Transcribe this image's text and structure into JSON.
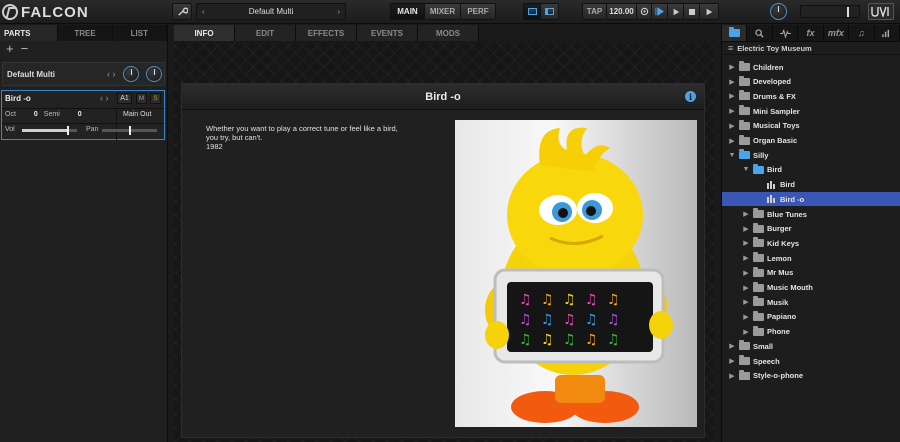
{
  "app": {
    "name": "FALCON"
  },
  "toolbar": {
    "preset_name": "Default Multi",
    "view_tabs": [
      "MAIN",
      "MIXER",
      "PERF"
    ],
    "tap_label": "TAP",
    "tempo": "120.00"
  },
  "left": {
    "tabs": [
      "PARTS",
      "TREE",
      "LIST"
    ],
    "multi_name": "Default Multi",
    "part": {
      "name": "Bird -o",
      "slot": "A1",
      "mute": "M",
      "solo": "S",
      "oct_label": "Oct",
      "oct_value": "0",
      "semi_label": "Semi",
      "semi_value": "0",
      "output": "Main Out",
      "vol_label": "Vol",
      "pan_label": "Pan",
      "vol_level": 0.85,
      "pan_level": 0.5
    }
  },
  "center": {
    "tabs": [
      "INFO",
      "EDIT",
      "EFFECTS",
      "EVENTS",
      "MODS"
    ],
    "preset_title": "Bird -o",
    "description_lines": [
      "Whether you want to play a correct tune or feel like a bird,",
      "you try, but can't.",
      "1982"
    ]
  },
  "right": {
    "tab_icons": [
      "folder-icon",
      "search-icon",
      "waveform-icon",
      "fx-icon",
      "mfx-icon",
      "note-icon",
      "meter-icon"
    ],
    "tab_labels": {
      "fx": "fx",
      "mfx": "mfx"
    },
    "library_name": "Electric Toy Museum",
    "tree": [
      {
        "label": "Children",
        "depth": 0,
        "type": "folder",
        "expanded": false
      },
      {
        "label": "Developed",
        "depth": 0,
        "type": "folder",
        "expanded": false
      },
      {
        "label": "Drums & FX",
        "depth": 0,
        "type": "folder",
        "expanded": false
      },
      {
        "label": "Mini Sampler",
        "depth": 0,
        "type": "folder",
        "expanded": false
      },
      {
        "label": "Musical Toys",
        "depth": 0,
        "type": "folder",
        "expanded": false
      },
      {
        "label": "Organ Basic",
        "depth": 0,
        "type": "folder",
        "expanded": false
      },
      {
        "label": "Silly",
        "depth": 0,
        "type": "folder",
        "expanded": true
      },
      {
        "label": "Bird",
        "depth": 1,
        "type": "folder",
        "expanded": true
      },
      {
        "label": "Bird",
        "depth": 2,
        "type": "preset"
      },
      {
        "label": "Bird -o",
        "depth": 2,
        "type": "preset",
        "selected": true
      },
      {
        "label": "Blue Tunes",
        "depth": 1,
        "type": "folder",
        "expanded": false
      },
      {
        "label": "Burger",
        "depth": 1,
        "type": "folder",
        "expanded": false
      },
      {
        "label": "Kid Keys",
        "depth": 1,
        "type": "folder",
        "expanded": false
      },
      {
        "label": "Lemon",
        "depth": 1,
        "type": "folder",
        "expanded": false
      },
      {
        "label": "Mr Mus",
        "depth": 1,
        "type": "folder",
        "expanded": false
      },
      {
        "label": "Music Mouth",
        "depth": 1,
        "type": "folder",
        "expanded": false
      },
      {
        "label": "Musik",
        "depth": 1,
        "type": "folder",
        "expanded": false
      },
      {
        "label": "Papiano",
        "depth": 1,
        "type": "folder",
        "expanded": false
      },
      {
        "label": "Phone",
        "depth": 1,
        "type": "folder",
        "expanded": false
      },
      {
        "label": "Small",
        "depth": 0,
        "type": "folder",
        "expanded": false
      },
      {
        "label": "Speech",
        "depth": 0,
        "type": "folder",
        "expanded": false
      },
      {
        "label": "Style-o-phone",
        "depth": 0,
        "type": "folder",
        "expanded": false
      }
    ]
  },
  "colors": {
    "accent": "#4aa5e8",
    "selection": "#3a57b5",
    "part_border": "#3a86c8"
  }
}
